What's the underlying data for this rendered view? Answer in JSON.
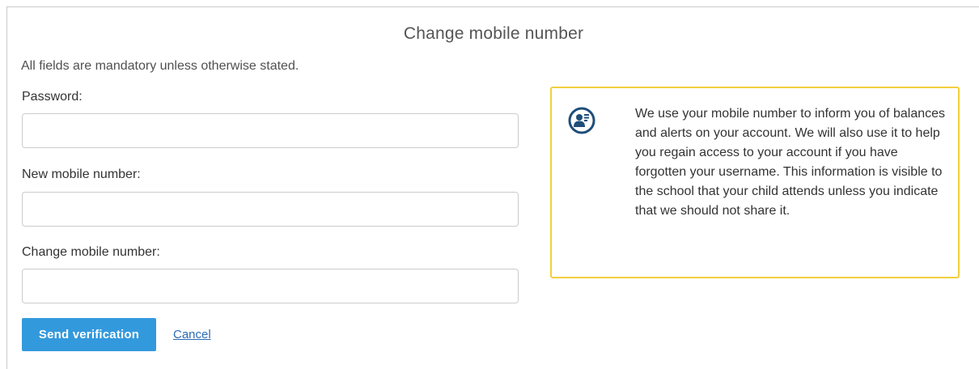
{
  "page": {
    "title": "Change mobile number",
    "mandatory_note": "All fields are mandatory unless otherwise stated."
  },
  "form": {
    "password_label": "Password:",
    "password_value": "",
    "new_mobile_label": "New mobile number:",
    "new_mobile_value": "",
    "confirm_mobile_label": "Change mobile number:",
    "confirm_mobile_value": "",
    "send_button_label": "Send verification",
    "cancel_link_label": "Cancel"
  },
  "info": {
    "icon": "user-info-icon",
    "text": "We use your mobile number to inform you of balances and alerts on your account. We will also use it to help you regain access to your account if you have forgotten your username. This information is visible to the school that your child attends unless you indicate that we should not share it."
  },
  "colors": {
    "primary_button": "#3399dd",
    "info_border": "#f2cf3d",
    "icon_color": "#1f4e79",
    "link": "#2a6db5"
  }
}
